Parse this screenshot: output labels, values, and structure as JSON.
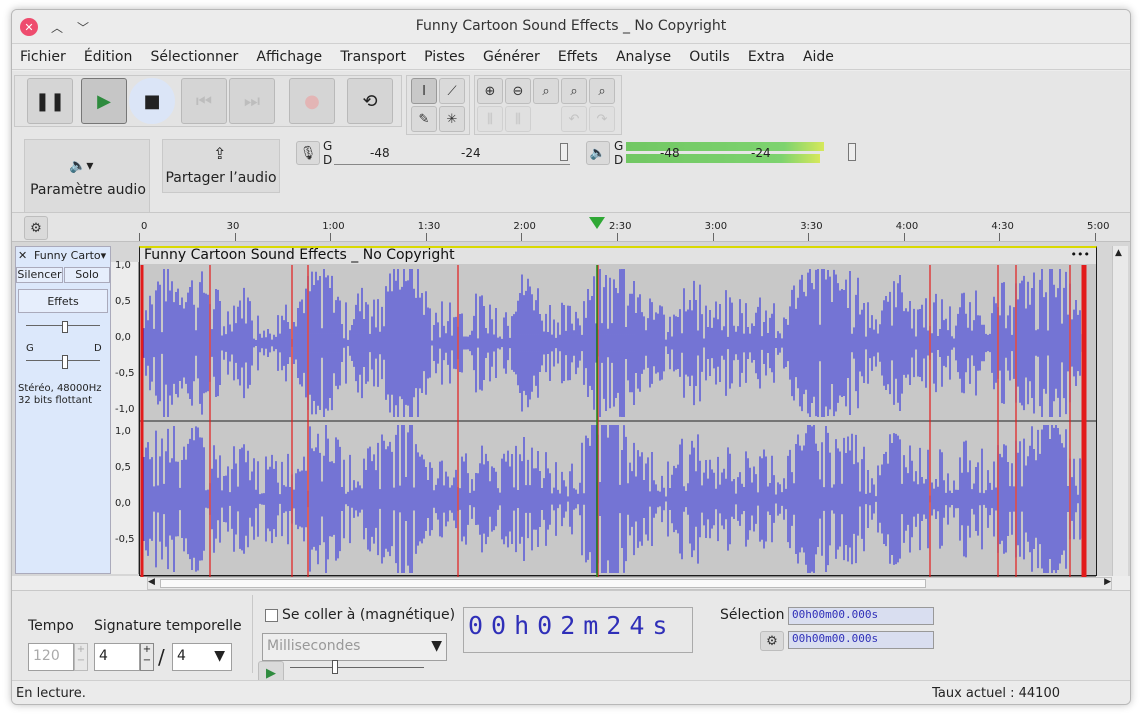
{
  "window": {
    "title": "Funny Cartoon Sound Effects _ No Copyright"
  },
  "menu": [
    "Fichier",
    "Édition",
    "Sélectionner",
    "Affichage",
    "Transport",
    "Pistes",
    "Générer",
    "Effets",
    "Analyse",
    "Outils",
    "Extra",
    "Aide"
  ],
  "audio_setup": {
    "label": "Paramètre audio"
  },
  "share": {
    "label": "Partager l’audio"
  },
  "meters": {
    "rec_channels": [
      "G",
      "D"
    ],
    "play_channels": [
      "G",
      "D"
    ],
    "rec_ticks": [
      "-48",
      "-24"
    ],
    "play_ticks": [
      "-48",
      "-24"
    ]
  },
  "timeline": {
    "ticks": [
      "0",
      "30",
      "1:00",
      "1:30",
      "2:00",
      "2:30",
      "3:00",
      "3:30",
      "4:00",
      "4:30",
      "5:00"
    ]
  },
  "track": {
    "name": "Funny Carto",
    "mute": "Silencer",
    "solo": "Solo",
    "effects": "Effets",
    "pan_left": "G",
    "pan_right": "D",
    "info_line1": "Stéréo, 48000Hz",
    "info_line2": "32 bits flottant",
    "clip_title": "Funny Cartoon Sound Effects _ No Copyright",
    "clip_menu": "•••",
    "ruler_top": [
      "1,0",
      "0,5",
      "0,0",
      "-0,5",
      "-1,0"
    ],
    "ruler_bottom": [
      "1,0",
      "0,5",
      "0,0",
      "-0,5"
    ]
  },
  "tempo": {
    "label": "Tempo",
    "value": "120"
  },
  "signature": {
    "label": "Signature temporelle",
    "numerator": "4",
    "separator": "/",
    "denominator": "4"
  },
  "snap": {
    "label": "Se coller à (magnétique)",
    "unit": "Millisecondes"
  },
  "time_display": {
    "value": "00h02m24s"
  },
  "selection": {
    "label": "Sélection",
    "start": "00h00m00.000s",
    "end": "00h00m00.000s"
  },
  "status": {
    "left": "En lecture.",
    "right": "Taux actuel : 44100"
  },
  "colors": {
    "waveform": "#3d3ddc",
    "clip_bg": "#c8c8c8",
    "cursor": "#1c8f1c",
    "clip_marker": "#e21b1b",
    "meter_green": "#7dd36f"
  }
}
